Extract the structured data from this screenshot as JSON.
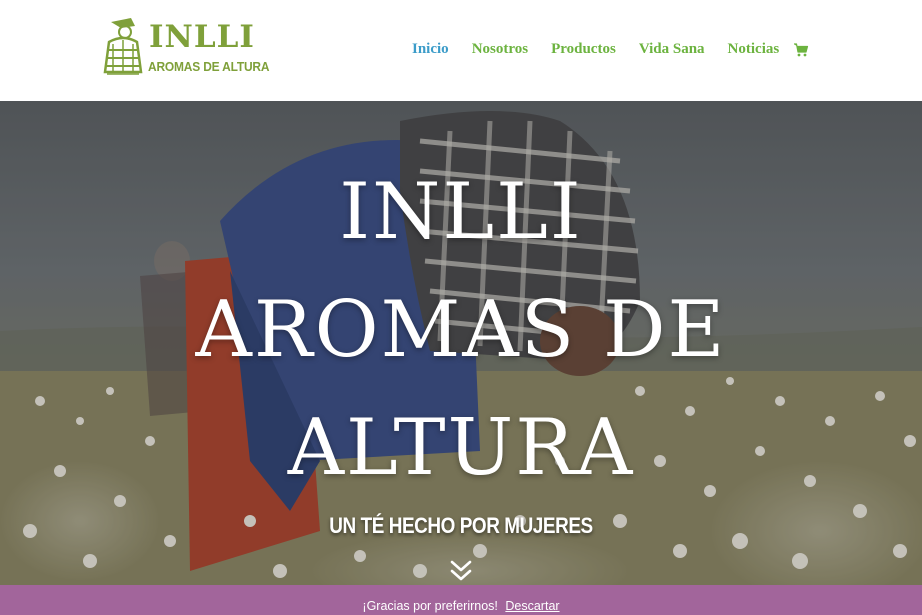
{
  "header": {
    "logo": {
      "title": "INLLI",
      "subtitle": "AROMAS DE ALTURA"
    },
    "nav": [
      {
        "label": "Inicio",
        "active": true
      },
      {
        "label": "Nosotros",
        "active": false
      },
      {
        "label": "Productos",
        "active": false
      },
      {
        "label": "Vida Sana",
        "active": false
      },
      {
        "label": "Noticias",
        "active": false
      }
    ],
    "cart_icon": "shopping-cart-icon"
  },
  "hero": {
    "title_line1": "INLLI",
    "title_line2": "AROMAS DE",
    "title_line3": "ALTURA",
    "subtitle": "UN TÉ HECHO POR MUJERES",
    "scroll_icon": "double-chevron-down-icon"
  },
  "notice": {
    "message": "¡Gracias por preferirnos!",
    "dismiss_label": "Descartar"
  },
  "colors": {
    "brand_green": "#7fa03a",
    "nav_green": "#6cb33f",
    "nav_active_blue": "#3c9cc9",
    "notice_purple": "#a2659b"
  }
}
